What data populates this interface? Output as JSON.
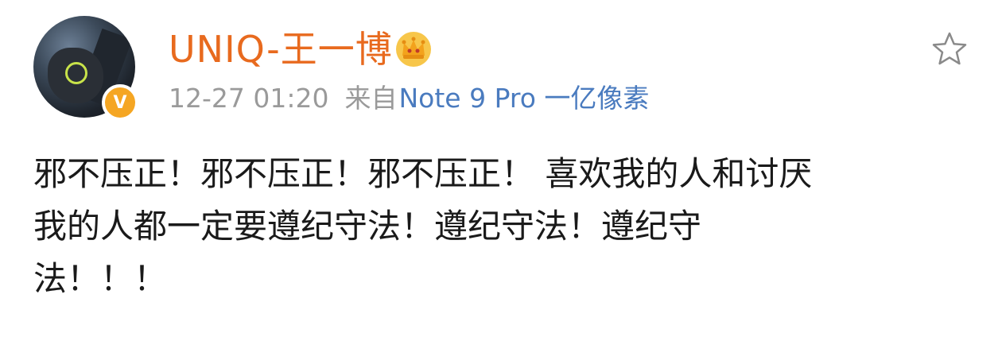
{
  "post": {
    "username": "UNIQ-王一博",
    "verified_badge": "V",
    "timestamp": "12-27 01:20",
    "source_label": "来自",
    "device": "Note 9 Pro 一亿像素",
    "content_lines": [
      "邪不压正！邪不压正！邪不压正！ 喜欢我的人和讨厌",
      "我的人都一定要遵纪守法！遵纪守法！遵纪守",
      "法！！！"
    ],
    "icons": {
      "crown": "crown-icon",
      "favorite": "star-icon"
    },
    "colors": {
      "username": "#e86a1e",
      "meta": "#9a9a9a",
      "device": "#4a7bbf",
      "badge": "#f5a623",
      "content": "#1a1a1a"
    }
  }
}
